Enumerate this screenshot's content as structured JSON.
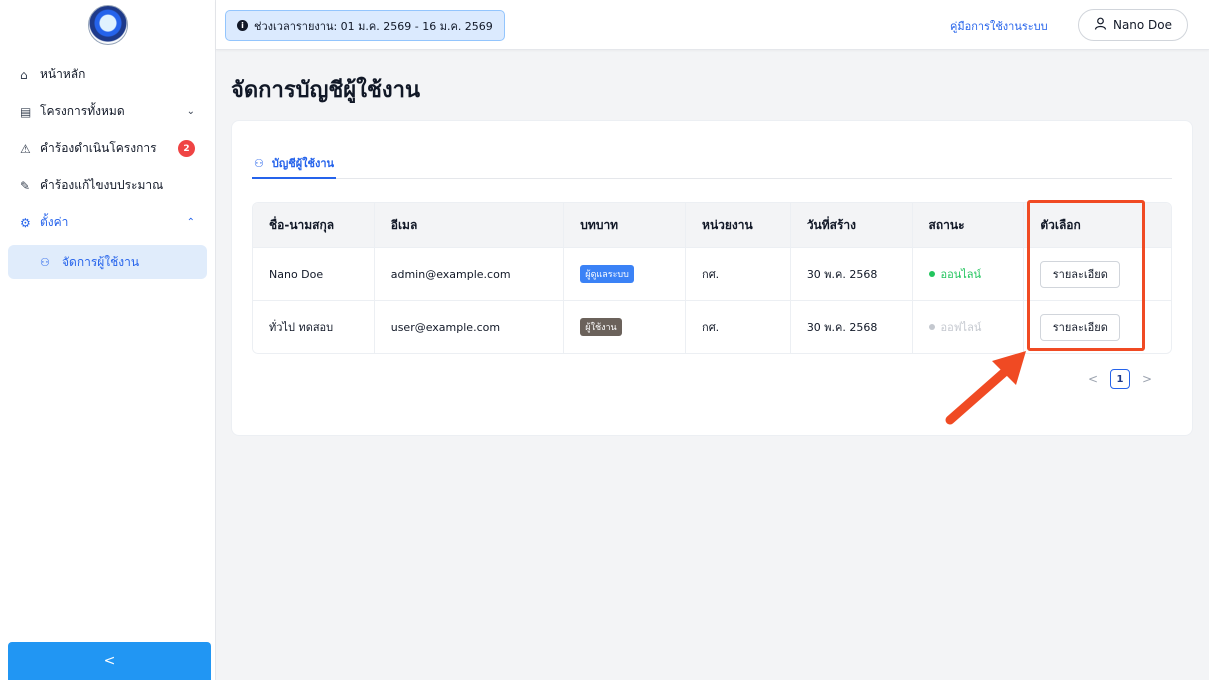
{
  "sidebar": {
    "items": [
      {
        "icon": "home-icon",
        "label": "หน้าหลัก"
      },
      {
        "icon": "projects-icon",
        "label": "โครงการทั้งหมด"
      },
      {
        "icon": "request-icon",
        "label": "คำร้องดำเนินโครงการ",
        "badge": "2"
      },
      {
        "icon": "edit-icon",
        "label": "คำร้องแก้ไขงบประมาณ"
      },
      {
        "icon": "gear-icon",
        "label": "ตั้งค่า"
      }
    ],
    "submenu": {
      "icon": "users-icon",
      "label": "จัดการผู้ใช้งาน"
    },
    "collapse_label": "<"
  },
  "topbar": {
    "period": "ช่วงเวลารายงาน: 01 ม.ค. 2569 - 16 ม.ค. 2569",
    "manual_link": "คู่มือการใช้งานระบบ",
    "user_name": "Nano Doe"
  },
  "main": {
    "title": "จัดการบัญชีผู้ใช้งาน",
    "tab_label": "บัญชีผู้ใช้งาน",
    "table": {
      "headers": [
        "ชื่อ-นามสกุล",
        "อีเมล",
        "บทบาท",
        "หน่วยงาน",
        "วันที่สร้าง",
        "สถานะ",
        "ตัวเลือก"
      ],
      "rows": [
        {
          "name": "Nano Doe",
          "email": "admin@example.com",
          "role": "ผู้ดูแลระบบ",
          "unit": "กศ.",
          "created": "30 พ.ค. 2568",
          "status": "ออนไลน์",
          "action": "รายละเอียด"
        },
        {
          "name": "ทั่วไป ทดสอบ",
          "email": "user@example.com",
          "role": "ผู้ใช้งาน",
          "unit": "กศ.",
          "created": "30 พ.ค. 2568",
          "status": "ออฟไลน์",
          "action": "รายละเอียด"
        }
      ]
    },
    "pagination": {
      "prev": "<",
      "current": "1",
      "next": ">"
    }
  },
  "colors": {
    "accent": "#2563eb",
    "highlight": "#f04a23",
    "online": "#22c55e",
    "badge": "#ef4444"
  }
}
